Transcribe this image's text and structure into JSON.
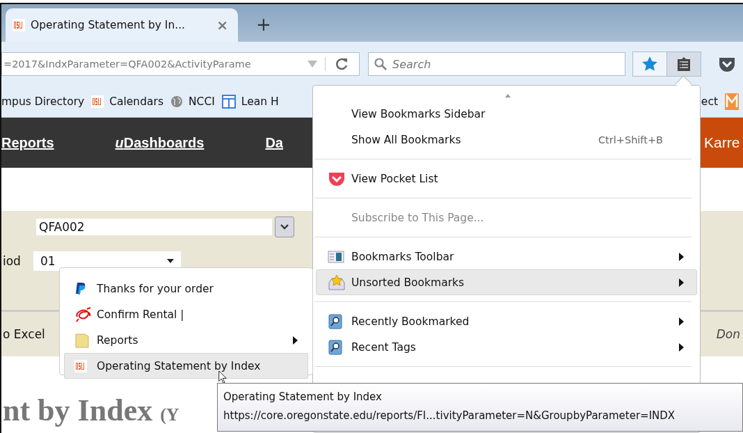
{
  "tab": {
    "title": "Operating Statement by In...",
    "close": "×",
    "new_tab": "+"
  },
  "address_bar": {
    "url": "=2017&IndxParameter=QFA002&ActivityParame"
  },
  "search": {
    "placeholder": "Search"
  },
  "bookmarks_toolbar": [
    {
      "label": "mpus Directory"
    },
    {
      "label": "Calendars"
    },
    {
      "label": "NCCI"
    },
    {
      "label": "Lean H"
    },
    {
      "label": "ect"
    }
  ],
  "site_nav": [
    {
      "label": "Reports"
    },
    {
      "prefix": "u",
      "label": "Dashboards"
    },
    {
      "label": "Da"
    }
  ],
  "user": "Karre",
  "form": {
    "index_value": "QFA002",
    "period_label": "iod",
    "period_value": "01"
  },
  "actions": {
    "export": "o Excel",
    "status": "Don"
  },
  "heading": {
    "main": "nt by Index",
    "sub": "(Y"
  },
  "bookmarks_menu": [
    {
      "kind": "item",
      "label": "View Bookmarks Sidebar",
      "disabled": false,
      "submenu": false,
      "selected": false
    },
    {
      "kind": "item",
      "label": "Show All Bookmarks",
      "shortcut": "Ctrl+Shift+B",
      "disabled": false,
      "submenu": false,
      "selected": false
    },
    {
      "kind": "separator"
    },
    {
      "kind": "item",
      "label": "View Pocket List",
      "disabled": false,
      "submenu": false,
      "selected": false
    },
    {
      "kind": "separator"
    },
    {
      "kind": "item",
      "label": "Subscribe to This Page...",
      "disabled": true,
      "submenu": false,
      "selected": false
    },
    {
      "kind": "separator"
    },
    {
      "kind": "item",
      "label": "Bookmarks Toolbar",
      "disabled": false,
      "submenu": true,
      "selected": false
    },
    {
      "kind": "item",
      "label": "Unsorted Bookmarks",
      "disabled": false,
      "submenu": true,
      "selected": true
    },
    {
      "kind": "separator"
    },
    {
      "kind": "item",
      "label": "Recently Bookmarked",
      "disabled": false,
      "submenu": true,
      "selected": false
    },
    {
      "kind": "item",
      "label": "Recent Tags",
      "disabled": false,
      "submenu": true,
      "selected": false
    },
    {
      "kind": "separator"
    }
  ],
  "submenu": [
    {
      "label": "Thanks for your order",
      "submenu": false,
      "selected": false
    },
    {
      "label": "Confirm Rental |",
      "submenu": false,
      "selected": false
    },
    {
      "label": "Reports",
      "submenu": true,
      "selected": false
    },
    {
      "label": "Operating Statement by Index",
      "submenu": false,
      "selected": true
    }
  ],
  "tooltip": {
    "title": "Operating Statement by Index",
    "url": "https://core.oregonstate.edu/reports/FI...tivityParameter=N&GroupbyParameter=INDX"
  }
}
